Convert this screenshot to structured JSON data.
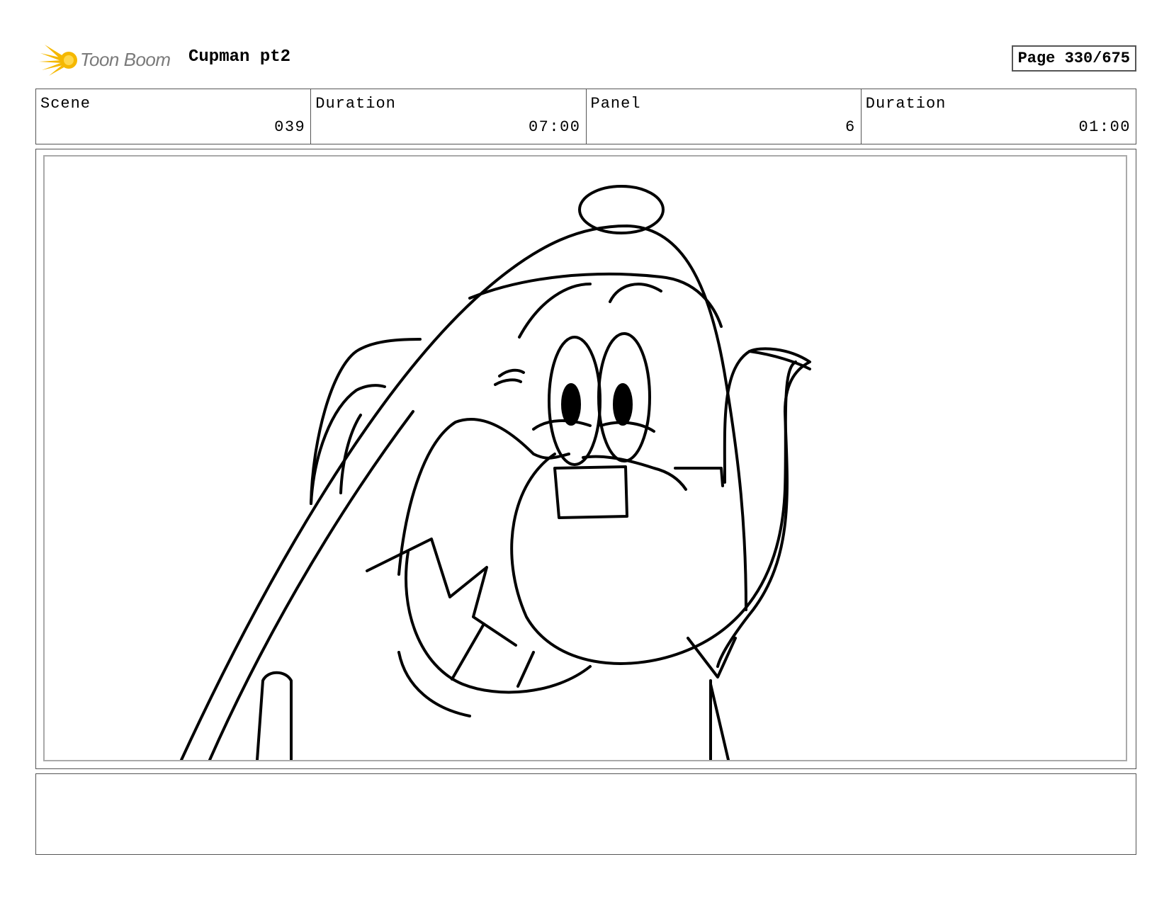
{
  "header": {
    "logo_text": "Toon Boom",
    "project_title": "Cupman pt2",
    "page_label": "Page 330/675"
  },
  "info": [
    {
      "label": "Scene",
      "value": "039"
    },
    {
      "label": "Duration",
      "value": "07:00"
    },
    {
      "label": "Panel",
      "value": "6"
    },
    {
      "label": "Duration",
      "value": "01:00"
    }
  ],
  "panel": {
    "subject": "teapot-character-sketch"
  },
  "notes": {
    "text": ""
  },
  "colors": {
    "logo_accent": "#f5b800",
    "border": "#555555",
    "inner_border": "#aaaaaa"
  }
}
